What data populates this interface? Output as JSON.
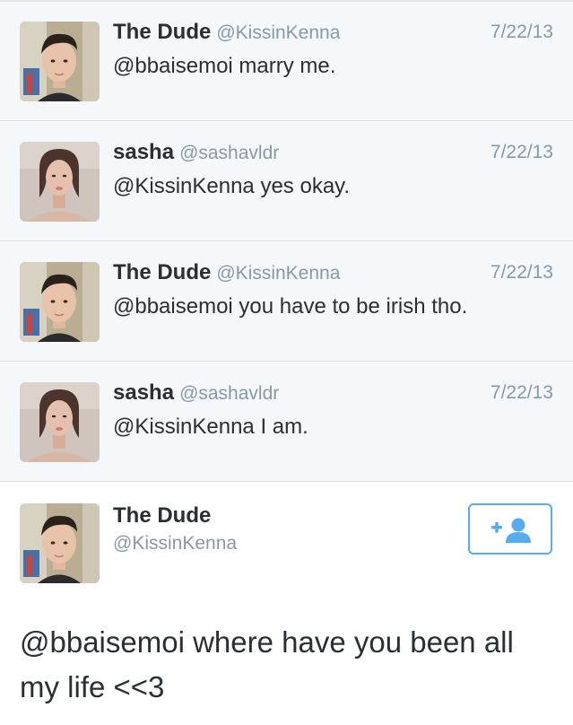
{
  "conversation": [
    {
      "name": "The Dude",
      "handle": "@KissinKenna",
      "date": "7/22/13",
      "text": "@bbaisemoi marry me.",
      "avatar": "male-avatar"
    },
    {
      "name": "sasha",
      "handle": "@sashavldr",
      "date": "7/22/13",
      "text": "@KissinKenna yes okay.",
      "avatar": "female-avatar"
    },
    {
      "name": "The Dude",
      "handle": "@KissinKenna",
      "date": "7/22/13",
      "text": "@bbaisemoi you have to be irish tho.",
      "avatar": "male-avatar"
    },
    {
      "name": "sasha",
      "handle": "@sashavldr",
      "date": "7/22/13",
      "text": "@KissinKenna I am.",
      "avatar": "female-avatar"
    }
  ],
  "main_tweet": {
    "name": "The Dude",
    "handle": "@KissinKenna",
    "text": "@bbaisemoi where have you been all my life <<3",
    "follow_icon": "add-user-icon",
    "avatar": "male-avatar"
  },
  "colors": {
    "name": "#292f33",
    "meta": "#8899a6",
    "accent": "#55acee",
    "card_bg": "#f5f8fa",
    "divider": "#d8dee3"
  }
}
